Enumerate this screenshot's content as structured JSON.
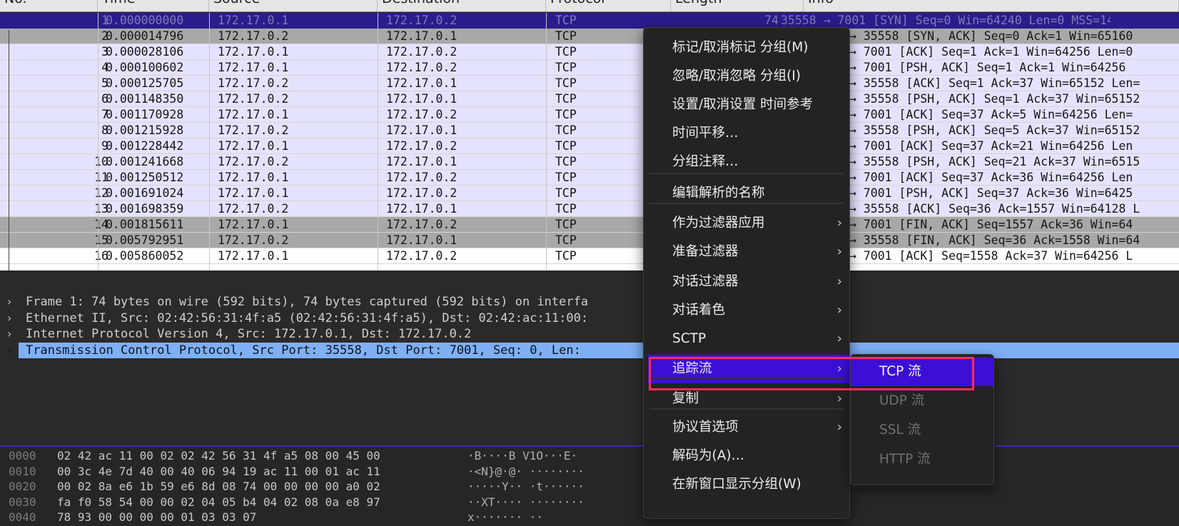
{
  "columns": [
    "No.",
    "Time",
    "Source",
    "Destination",
    "Protocol",
    "Length",
    "Info"
  ],
  "packets": [
    {
      "no": "1",
      "time": "0.000000000",
      "src": "172.17.0.1",
      "dst": "172.17.0.2",
      "proto": "TCP",
      "len": "74",
      "info": "35558 → 7001 [SYN] Seq=0 Win=64240 Len=0 MSS=14"
    },
    {
      "no": "2",
      "time": "0.000014796",
      "src": "172.17.0.2",
      "dst": "172.17.0.1",
      "proto": "TCP",
      "len": "",
      "info": "→ 35558 [SYN, ACK] Seq=0 Ack=1 Win=65160"
    },
    {
      "no": "3",
      "time": "0.000028106",
      "src": "172.17.0.1",
      "dst": "172.17.0.2",
      "proto": "TCP",
      "len": "",
      "info": "→ 7001 [ACK] Seq=1 Ack=1 Win=64256 Len=0"
    },
    {
      "no": "4",
      "time": "0.000100602",
      "src": "172.17.0.1",
      "dst": "172.17.0.2",
      "proto": "TCP",
      "len": "",
      "info": "→ 7001 [PSH, ACK] Seq=1 Ack=1 Win=64256"
    },
    {
      "no": "5",
      "time": "0.000125705",
      "src": "172.17.0.2",
      "dst": "172.17.0.1",
      "proto": "TCP",
      "len": "",
      "info": "→ 35558 [ACK] Seq=1 Ack=37 Win=65152 Len="
    },
    {
      "no": "6",
      "time": "0.001148350",
      "src": "172.17.0.2",
      "dst": "172.17.0.1",
      "proto": "TCP",
      "len": "",
      "info": "→ 35558 [PSH, ACK] Seq=1 Ack=37 Win=65152"
    },
    {
      "no": "7",
      "time": "0.001170928",
      "src": "172.17.0.1",
      "dst": "172.17.0.2",
      "proto": "TCP",
      "len": "",
      "info": "→ 7001 [ACK] Seq=37 Ack=5 Win=64256 Len="
    },
    {
      "no": "8",
      "time": "0.001215928",
      "src": "172.17.0.2",
      "dst": "172.17.0.1",
      "proto": "TCP",
      "len": "",
      "info": "→ 35558 [PSH, ACK] Seq=5 Ack=37 Win=65152"
    },
    {
      "no": "9",
      "time": "0.001228442",
      "src": "172.17.0.1",
      "dst": "172.17.0.2",
      "proto": "TCP",
      "len": "",
      "info": "→ 7001 [ACK] Seq=37 Ack=21 Win=64256 Len"
    },
    {
      "no": "10",
      "time": "0.001241668",
      "src": "172.17.0.2",
      "dst": "172.17.0.1",
      "proto": "TCP",
      "len": "",
      "info": "→ 35558 [PSH, ACK] Seq=21 Ack=37 Win=6515"
    },
    {
      "no": "11",
      "time": "0.001250512",
      "src": "172.17.0.1",
      "dst": "172.17.0.2",
      "proto": "TCP",
      "len": "",
      "info": "→ 7001 [ACK] Seq=37 Ack=36 Win=64256 Len"
    },
    {
      "no": "12",
      "time": "0.001691024",
      "src": "172.17.0.1",
      "dst": "172.17.0.2",
      "proto": "TCP",
      "len": "",
      "info": "→ 7001 [PSH, ACK] Seq=37 Ack=36 Win=6425"
    },
    {
      "no": "13",
      "time": "0.001698359",
      "src": "172.17.0.2",
      "dst": "172.17.0.1",
      "proto": "TCP",
      "len": "",
      "info": "→ 35558 [ACK] Seq=36 Ack=1557 Win=64128 L"
    },
    {
      "no": "14",
      "time": "0.001815611",
      "src": "172.17.0.1",
      "dst": "172.17.0.2",
      "proto": "TCP",
      "len": "",
      "info": "→ 7001 [FIN, ACK] Seq=1557 Ack=36 Win=64"
    },
    {
      "no": "15",
      "time": "0.005792951",
      "src": "172.17.0.2",
      "dst": "172.17.0.1",
      "proto": "TCP",
      "len": "",
      "info": "→ 35558 [FIN, ACK] Seq=36 Ack=1558 Win=64"
    },
    {
      "no": "16",
      "time": "0.005860052",
      "src": "172.17.0.1",
      "dst": "172.17.0.2",
      "proto": "TCP",
      "len": "",
      "info": "→ 7001 [ACK] Seq=1558 Ack=37 Win=64256 L"
    }
  ],
  "detail": [
    "Frame 1: 74 bytes on wire (592 bits), 74 bytes captured (592 bits) on interfa",
    "Ethernet II, Src: 02:42:56:31:4f:a5 (02:42:56:31:4f:a5), Dst: 02:42:ac:11:00:",
    "Internet Protocol Version 4, Src: 172.17.0.1, Dst: 172.17.0.2",
    "Transmission Control Protocol, Src Port: 35558, Dst Port: 7001, Seq: 0, Len:"
  ],
  "bytes": [
    {
      "off": "0000",
      "hex": "02 42 ac 11 00 02 02 42  56 31 4f a5 08 00 45 00",
      "ascii": "·B····B V1O···E·"
    },
    {
      "off": "0010",
      "hex": "00 3c 4e 7d 40 00 40 06  94 19 ac 11 00 01 ac 11",
      "ascii": "·<N}@·@· ········"
    },
    {
      "off": "0020",
      "hex": "00 02 8a e6 1b 59 e6 8d  08 74 00 00 00 00 a0 02",
      "ascii": "·····Y·· ·t······"
    },
    {
      "off": "0030",
      "hex": "fa f0 58 54 00 00 02 04  05 b4 04 02 08 0a e8 97",
      "ascii": "··XT···· ········"
    },
    {
      "off": "0040",
      "hex": "78 93 00 00 00 00 01 03  03 07",
      "ascii": "x······· ··"
    }
  ],
  "menu": [
    {
      "label": "标记/取消标记 分组(M)",
      "sub": false
    },
    {
      "label": "忽略/取消忽略 分组(I)",
      "sub": false
    },
    {
      "label": "设置/取消设置 时间参考",
      "sub": false
    },
    {
      "label": "时间平移…",
      "sub": false
    },
    {
      "label": "分组注释…",
      "sub": false
    },
    {
      "label": "编辑解析的名称",
      "sub": false
    },
    {
      "label": "作为过滤器应用",
      "sub": true
    },
    {
      "label": "准备过滤器",
      "sub": true
    },
    {
      "label": "对话过滤器",
      "sub": true
    },
    {
      "label": "对话着色",
      "sub": true
    },
    {
      "label": "SCTP",
      "sub": true
    },
    {
      "label": "追踪流",
      "sub": true
    },
    {
      "label": "复制",
      "sub": true
    },
    {
      "label": "协议首选项",
      "sub": true
    },
    {
      "label": "解码为(A)…",
      "sub": false
    },
    {
      "label": "在新窗口显示分组(W)",
      "sub": false
    }
  ],
  "submenu": [
    {
      "label": "TCP 流",
      "enabled": true
    },
    {
      "label": "UDP 流",
      "enabled": false
    },
    {
      "label": "SSL 流",
      "enabled": false
    },
    {
      "label": "HTTP 流",
      "enabled": false
    }
  ],
  "colors": {
    "selected_row": "#2a1c8c",
    "menu_highlight": "#3b0fd6",
    "detail_selected": "#7fb0f4",
    "annotation_box": "#ff2d55"
  }
}
